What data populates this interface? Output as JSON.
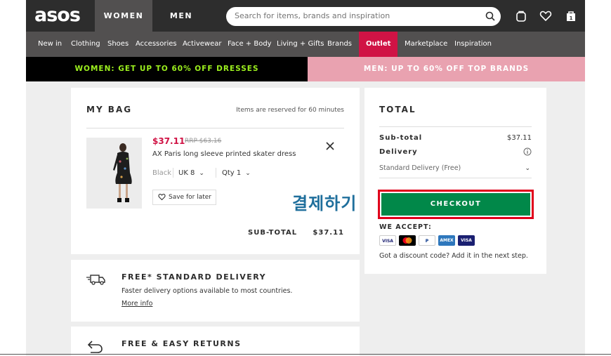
{
  "header": {
    "logo": "asos",
    "tabs": [
      "WOMEN",
      "MEN"
    ],
    "search_placeholder": "Search for items, brands and inspiration"
  },
  "nav": {
    "items": [
      "New in",
      "Clothing",
      "Shoes",
      "Accessories",
      "Activewear",
      "Face + Body",
      "Living + Gifts",
      "Brands",
      "Outlet",
      "Marketplace",
      "Inspiration"
    ]
  },
  "promo": {
    "women": "WOMEN: GET UP TO 60% OFF DRESSES",
    "men": "MEN: UP TO 60% OFF TOP BRANDS"
  },
  "bag": {
    "title": "MY BAG",
    "note": "Items are reserved for 60 minutes",
    "item": {
      "price": "$37.11",
      "rrp": "RRP $63.16",
      "name": "AX Paris long sleeve printed skater dress",
      "color": "Black",
      "size": "UK 8",
      "qty": "Qty 1",
      "save_label": "Save for later"
    },
    "subtotal_label": "SUB-TOTAL",
    "subtotal_value": "$37.11"
  },
  "delivery": {
    "title": "FREE* STANDARD DELIVERY",
    "text": "Faster delivery options available to most countries.",
    "link": "More info"
  },
  "returns": {
    "title": "FREE & EASY RETURNS"
  },
  "total": {
    "title": "TOTAL",
    "subtotal_label": "Sub-total",
    "subtotal_value": "$37.11",
    "delivery_label": "Delivery",
    "delivery_option": "Standard Delivery (Free)",
    "checkout_label": "CHECKOUT",
    "accept_label": "WE ACCEPT:",
    "payment_cards": [
      "VISA",
      "MC",
      "PayPal",
      "AMEX",
      "VISA"
    ],
    "discount_text": "Got a discount code? Add it in the next step."
  },
  "overlay": {
    "korean": "결제하기"
  },
  "colors": {
    "outlet": "#d01345",
    "checkout": "#018849",
    "highlight": "#e0001b",
    "promo_women_text": "#9cf01e",
    "promo_men_bg": "#e9a2b0"
  }
}
